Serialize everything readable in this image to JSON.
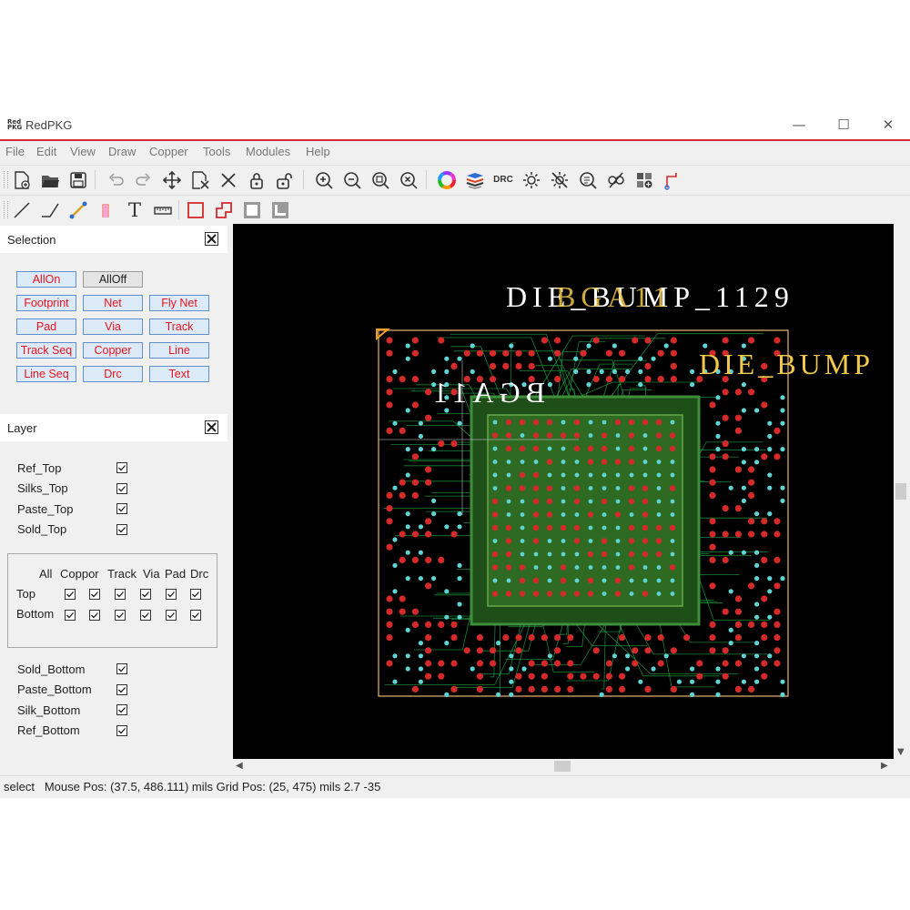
{
  "window": {
    "title": "RedPKG",
    "logo_text": "Red PKG"
  },
  "window_controls": {
    "minimize": "—",
    "maximize": "☐",
    "close": "✕"
  },
  "menu": [
    "File",
    "Edit",
    "View",
    "Draw",
    "Copper",
    "Tools",
    "Modules",
    "Help"
  ],
  "toolbar_main": [
    {
      "name": "new-file-icon"
    },
    {
      "name": "open-folder-icon"
    },
    {
      "name": "save-icon"
    },
    {
      "name": "undo-icon"
    },
    {
      "name": "redo-icon"
    },
    {
      "name": "move-icon"
    },
    {
      "name": "select-box-icon"
    },
    {
      "name": "delete-icon"
    },
    {
      "name": "lock-icon"
    },
    {
      "name": "unlock-icon"
    },
    {
      "name": "zoom-in-icon"
    },
    {
      "name": "zoom-out-icon"
    },
    {
      "name": "zoom-fit-icon"
    },
    {
      "name": "zoom-clear-icon"
    },
    {
      "name": "color-wheel-icon"
    },
    {
      "name": "layer-stack-icon"
    },
    {
      "name": "drc-icon",
      "label": "DRC"
    },
    {
      "name": "brightness-icon"
    },
    {
      "name": "brightness-off-icon"
    },
    {
      "name": "inspect-icon"
    },
    {
      "name": "route-icon"
    },
    {
      "name": "module-icon"
    },
    {
      "name": "pin-icon"
    }
  ],
  "toolbar_draw": [
    {
      "name": "line-tool-icon"
    },
    {
      "name": "polyline-tool-icon"
    },
    {
      "name": "track-tool-icon"
    },
    {
      "name": "track-seq-tool-icon"
    },
    {
      "name": "text-tool-icon",
      "label": "T"
    },
    {
      "name": "ruler-tool-icon"
    },
    {
      "name": "rect-tool-icon"
    },
    {
      "name": "polygon-tool-icon"
    },
    {
      "name": "copper-rect-icon"
    },
    {
      "name": "copper-cut-icon"
    }
  ],
  "selection": {
    "title": "Selection",
    "buttons": [
      "AllOn",
      "AllOff",
      "Footprint",
      "Net",
      "Fly Net",
      "Pad",
      "Via",
      "Track",
      "Track Seq",
      "Copper",
      "Line",
      "Line Seq",
      "Drc",
      "Text"
    ]
  },
  "layer": {
    "title": "Layer",
    "top_layers": [
      "Ref_Top",
      "Silks_Top",
      "Paste_Top",
      "Sold_Top"
    ],
    "grid_columns": [
      "All",
      "Coppor",
      "Track",
      "Via",
      "Pad",
      "Drc"
    ],
    "grid_rows": [
      "Top",
      "Bottom"
    ],
    "bottom_layers": [
      "Sold_Bottom",
      "Paste_Bottom",
      "Silk_Bottom",
      "Ref_Bottom"
    ]
  },
  "canvas": {
    "labels": {
      "die_bump_1129": "DIE_BUMP_1129",
      "overlap": "BGA11",
      "die_bump": "DIE_BUMP",
      "bga_mirror": "BGA11"
    },
    "colors": {
      "background": "#000000",
      "pad": "#d42a2a",
      "via": "#5fd4d4",
      "trace": "#1fae4a",
      "outline": "#d9a96a",
      "label": "#f2c84b"
    }
  },
  "status": {
    "mode": "select",
    "mouse_pos": "Mouse Pos: (37.5, 486.111) mils",
    "grid_pos": "Grid Pos: (25, 475) mils",
    "extra": "2.7 -35"
  }
}
